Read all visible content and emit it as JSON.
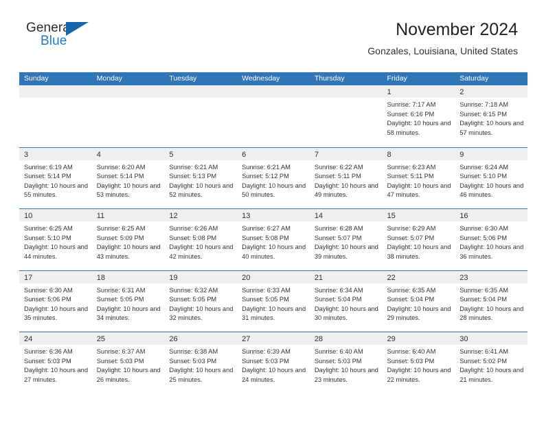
{
  "brand": {
    "name_part1": "General",
    "name_part2": "Blue",
    "triangle_color": "#1565a8",
    "blue_text_color": "#1a7ac4"
  },
  "header": {
    "month_title": "November 2024",
    "location": "Gonzales, Louisiana, United States"
  },
  "theme": {
    "header_blue": "#3075b8",
    "day_band_gray": "#efefef",
    "text_color": "#333333"
  },
  "calendar": {
    "weekdays": [
      "Sunday",
      "Monday",
      "Tuesday",
      "Wednesday",
      "Thursday",
      "Friday",
      "Saturday"
    ],
    "weeks": [
      [
        {
          "empty": true
        },
        {
          "empty": true
        },
        {
          "empty": true
        },
        {
          "empty": true
        },
        {
          "empty": true
        },
        {
          "day": "1",
          "sunrise": "Sunrise: 7:17 AM",
          "sunset": "Sunset: 6:16 PM",
          "daylight": "Daylight: 10 hours and 58 minutes."
        },
        {
          "day": "2",
          "sunrise": "Sunrise: 7:18 AM",
          "sunset": "Sunset: 6:15 PM",
          "daylight": "Daylight: 10 hours and 57 minutes."
        }
      ],
      [
        {
          "day": "3",
          "sunrise": "Sunrise: 6:19 AM",
          "sunset": "Sunset: 5:14 PM",
          "daylight": "Daylight: 10 hours and 55 minutes."
        },
        {
          "day": "4",
          "sunrise": "Sunrise: 6:20 AM",
          "sunset": "Sunset: 5:14 PM",
          "daylight": "Daylight: 10 hours and 53 minutes."
        },
        {
          "day": "5",
          "sunrise": "Sunrise: 6:21 AM",
          "sunset": "Sunset: 5:13 PM",
          "daylight": "Daylight: 10 hours and 52 minutes."
        },
        {
          "day": "6",
          "sunrise": "Sunrise: 6:21 AM",
          "sunset": "Sunset: 5:12 PM",
          "daylight": "Daylight: 10 hours and 50 minutes."
        },
        {
          "day": "7",
          "sunrise": "Sunrise: 6:22 AM",
          "sunset": "Sunset: 5:11 PM",
          "daylight": "Daylight: 10 hours and 49 minutes."
        },
        {
          "day": "8",
          "sunrise": "Sunrise: 6:23 AM",
          "sunset": "Sunset: 5:11 PM",
          "daylight": "Daylight: 10 hours and 47 minutes."
        },
        {
          "day": "9",
          "sunrise": "Sunrise: 6:24 AM",
          "sunset": "Sunset: 5:10 PM",
          "daylight": "Daylight: 10 hours and 46 minutes."
        }
      ],
      [
        {
          "day": "10",
          "sunrise": "Sunrise: 6:25 AM",
          "sunset": "Sunset: 5:10 PM",
          "daylight": "Daylight: 10 hours and 44 minutes."
        },
        {
          "day": "11",
          "sunrise": "Sunrise: 6:25 AM",
          "sunset": "Sunset: 5:09 PM",
          "daylight": "Daylight: 10 hours and 43 minutes."
        },
        {
          "day": "12",
          "sunrise": "Sunrise: 6:26 AM",
          "sunset": "Sunset: 5:08 PM",
          "daylight": "Daylight: 10 hours and 42 minutes."
        },
        {
          "day": "13",
          "sunrise": "Sunrise: 6:27 AM",
          "sunset": "Sunset: 5:08 PM",
          "daylight": "Daylight: 10 hours and 40 minutes."
        },
        {
          "day": "14",
          "sunrise": "Sunrise: 6:28 AM",
          "sunset": "Sunset: 5:07 PM",
          "daylight": "Daylight: 10 hours and 39 minutes."
        },
        {
          "day": "15",
          "sunrise": "Sunrise: 6:29 AM",
          "sunset": "Sunset: 5:07 PM",
          "daylight": "Daylight: 10 hours and 38 minutes."
        },
        {
          "day": "16",
          "sunrise": "Sunrise: 6:30 AM",
          "sunset": "Sunset: 5:06 PM",
          "daylight": "Daylight: 10 hours and 36 minutes."
        }
      ],
      [
        {
          "day": "17",
          "sunrise": "Sunrise: 6:30 AM",
          "sunset": "Sunset: 5:06 PM",
          "daylight": "Daylight: 10 hours and 35 minutes."
        },
        {
          "day": "18",
          "sunrise": "Sunrise: 6:31 AM",
          "sunset": "Sunset: 5:05 PM",
          "daylight": "Daylight: 10 hours and 34 minutes."
        },
        {
          "day": "19",
          "sunrise": "Sunrise: 6:32 AM",
          "sunset": "Sunset: 5:05 PM",
          "daylight": "Daylight: 10 hours and 32 minutes."
        },
        {
          "day": "20",
          "sunrise": "Sunrise: 6:33 AM",
          "sunset": "Sunset: 5:05 PM",
          "daylight": "Daylight: 10 hours and 31 minutes."
        },
        {
          "day": "21",
          "sunrise": "Sunrise: 6:34 AM",
          "sunset": "Sunset: 5:04 PM",
          "daylight": "Daylight: 10 hours and 30 minutes."
        },
        {
          "day": "22",
          "sunrise": "Sunrise: 6:35 AM",
          "sunset": "Sunset: 5:04 PM",
          "daylight": "Daylight: 10 hours and 29 minutes."
        },
        {
          "day": "23",
          "sunrise": "Sunrise: 6:35 AM",
          "sunset": "Sunset: 5:04 PM",
          "daylight": "Daylight: 10 hours and 28 minutes."
        }
      ],
      [
        {
          "day": "24",
          "sunrise": "Sunrise: 6:36 AM",
          "sunset": "Sunset: 5:03 PM",
          "daylight": "Daylight: 10 hours and 27 minutes."
        },
        {
          "day": "25",
          "sunrise": "Sunrise: 6:37 AM",
          "sunset": "Sunset: 5:03 PM",
          "daylight": "Daylight: 10 hours and 26 minutes."
        },
        {
          "day": "26",
          "sunrise": "Sunrise: 6:38 AM",
          "sunset": "Sunset: 5:03 PM",
          "daylight": "Daylight: 10 hours and 25 minutes."
        },
        {
          "day": "27",
          "sunrise": "Sunrise: 6:39 AM",
          "sunset": "Sunset: 5:03 PM",
          "daylight": "Daylight: 10 hours and 24 minutes."
        },
        {
          "day": "28",
          "sunrise": "Sunrise: 6:40 AM",
          "sunset": "Sunset: 5:03 PM",
          "daylight": "Daylight: 10 hours and 23 minutes."
        },
        {
          "day": "29",
          "sunrise": "Sunrise: 6:40 AM",
          "sunset": "Sunset: 5:03 PM",
          "daylight": "Daylight: 10 hours and 22 minutes."
        },
        {
          "day": "30",
          "sunrise": "Sunrise: 6:41 AM",
          "sunset": "Sunset: 5:02 PM",
          "daylight": "Daylight: 10 hours and 21 minutes."
        }
      ]
    ]
  }
}
